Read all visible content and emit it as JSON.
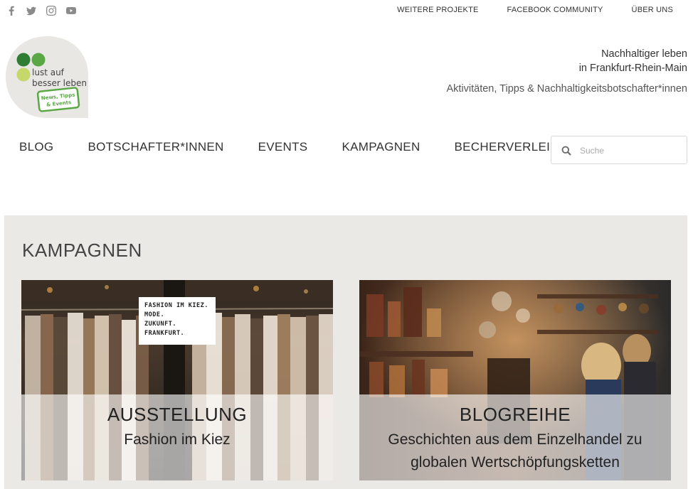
{
  "social": [
    {
      "icon": "facebook-icon"
    },
    {
      "icon": "twitter-icon"
    },
    {
      "icon": "instagram-icon"
    },
    {
      "icon": "youtube-icon"
    }
  ],
  "toplinks": [
    "WEITERE PROJEKTE",
    "FACEBOOK COMMUNITY",
    "ÜBER UNS"
  ],
  "logo": {
    "line1": "lust auf",
    "line2": "besser leben",
    "badge1": "News, Tipps",
    "badge2": "& Events"
  },
  "tagline": {
    "line1": "Nachhaltiger leben",
    "line2": "in Frankfurt-Rhein-Main",
    "line3": "Aktivitäten, Tipps & Nachhaltigkeitsbotschafter*innen"
  },
  "nav": [
    "BLOG",
    "BOTSCHAFTER*INNEN",
    "EVENTS",
    "KAMPAGNEN",
    "BECHERVERLEIH"
  ],
  "search": {
    "placeholder": "Suche"
  },
  "section": {
    "title": "KAMPAGNEN",
    "cards": [
      {
        "title": "AUSSTELLUNG",
        "subtitle": "Fashion im Kiez",
        "sign": [
          "FASHION IM KIEZ.",
          "MODE.",
          "ZUKUNFT.",
          "FRANKFURT."
        ]
      },
      {
        "title": "BLOGREIHE",
        "subtitle_line1": "Geschichten aus dem Einzelhandel zu",
        "subtitle_line2": "globalen Wertschöpfungsketten"
      }
    ]
  },
  "colors": {
    "accent_green": "#5aa845",
    "dark_green": "#2e7d32",
    "section_bg": "#ebe9e6"
  }
}
